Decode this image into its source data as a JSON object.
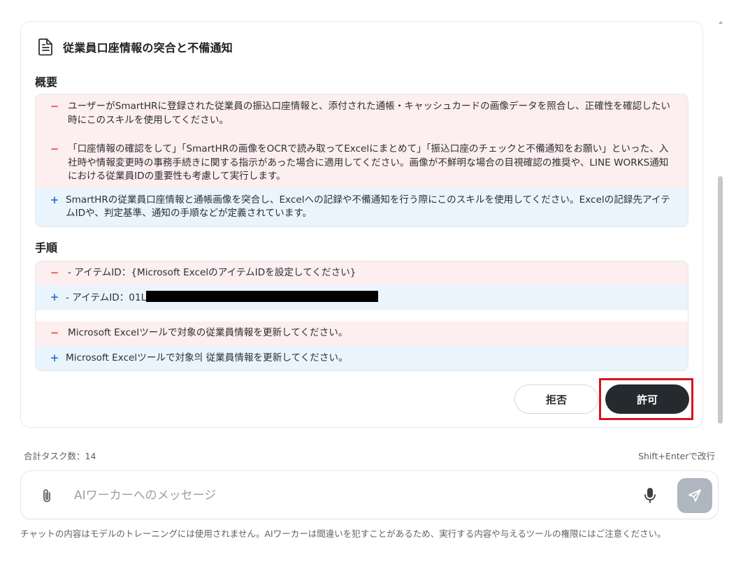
{
  "card": {
    "title": "従業員口座情報の突合と不備通知",
    "icon": "document-icon",
    "overview": {
      "heading": "概要",
      "lines": [
        {
          "type": "del",
          "sign": "−",
          "text": "ユーザーがSmartHRに登録された従業員の振込口座情報と、添付された通帳・キャッシュカードの画像データを照合し、正確性を確認したい時にこのスキルを使用してください。"
        },
        {
          "type": "del",
          "sign": "−",
          "text": "「口座情報の確認をして」「SmartHRの画像をOCRで読み取ってExcelにまとめて」「振込口座のチェックと不備通知をお願い」といった、入社時や情報変更時の事務手続きに関する指示があった場合に適用してください。画像が不鮮明な場合の目視確認の推奨や、LINE WORKS通知における従業員IDの重要性も考慮して実行します。"
        },
        {
          "type": "add",
          "sign": "+",
          "text": "SmartHRの従業員口座情報と通帳画像を突合し、Excelへの記録や不備通知を行う際にこのスキルを使用してください。Excelの記録先アイテムIDや、判定基準、通知の手順などが定義されています。"
        }
      ]
    },
    "steps": {
      "heading": "手順",
      "lines": [
        {
          "type": "del",
          "sign": "−",
          "text": "- アイテムID：{Microsoft ExcelのアイテムIDを設定してください}"
        },
        {
          "type": "add",
          "sign": "+",
          "text": "- アイテムID：01L"
        },
        {
          "type": "blank"
        },
        {
          "type": "del",
          "sign": "−",
          "text": "Microsoft Excelツールで対象の従業員情報を更新してください。"
        },
        {
          "type": "add",
          "sign": "+",
          "text": "Microsoft Excelツールで対象의 従業員情報を更新してください。"
        }
      ]
    },
    "buttons": {
      "reject": "拒否",
      "allow": "許可"
    }
  },
  "footer": {
    "task_count": "合計タスク数：14",
    "enter_hint": "Shift+Enterで改行",
    "input_placeholder": "AIワーカーへのメッセージ",
    "disclaimer": "チャットの内容はモデルのトレーニングには使用されません。AIワーカーは間違いを犯すことがあるため、実行する内容や与えるツールの権限にはご注意ください。"
  },
  "colors": {
    "del_bg": "#fdeeef",
    "add_bg": "#eaf4fc",
    "del_sign": "#e5534b",
    "add_sign": "#2b73d1",
    "allow_button": "#252a2f",
    "highlight": "#d8141c",
    "send_button": "#aeb6bf"
  }
}
